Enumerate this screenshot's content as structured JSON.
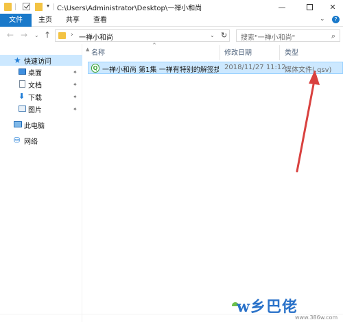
{
  "window": {
    "title": "C:\\Users\\Administrator\\Desktop\\一禅小和尚",
    "minimize": "—",
    "maximize": "",
    "close": "✕"
  },
  "ribbon": {
    "tabs": [
      "文件",
      "主页",
      "共享",
      "查看"
    ],
    "expand_icon": "⌄",
    "help_icon": "?"
  },
  "nav": {
    "back": "←",
    "forward": "→",
    "recent": "⌄",
    "up": "↑",
    "address_chevron": "›",
    "address_text": "一禅小和尚",
    "address_dropdown": "⌄",
    "refresh": "↻",
    "search_placeholder": "搜索\"一禅小和尚\"",
    "search_icon": "⌕"
  },
  "sidebar": {
    "items": [
      {
        "label": "快速访问",
        "icon": "star-icon"
      },
      {
        "label": "桌面",
        "icon": "desktop-icon",
        "pinned": true
      },
      {
        "label": "文档",
        "icon": "document-icon",
        "pinned": true
      },
      {
        "label": "下载",
        "icon": "download-icon",
        "pinned": true
      },
      {
        "label": "图片",
        "icon": "picture-icon",
        "pinned": true
      },
      {
        "label": "此电脑",
        "icon": "computer-icon"
      },
      {
        "label": "网络",
        "icon": "network-icon"
      }
    ],
    "pin_glyph": "✦"
  },
  "columns": {
    "name": "名称",
    "date": "修改日期",
    "type": "类型",
    "sort_indicator": "^"
  },
  "files": [
    {
      "name": "一禅小和尚 第1集 一禅有特别的解签技...",
      "date": "2018/11/27 11:12",
      "type": "媒体文件(.qsv)",
      "icon": "qsv-file-icon",
      "selected": true
    }
  ],
  "annotation": {
    "arrow_color": "#d9413f"
  },
  "watermark": {
    "text": "w乡巴佬",
    "url": "www.386w.com"
  }
}
